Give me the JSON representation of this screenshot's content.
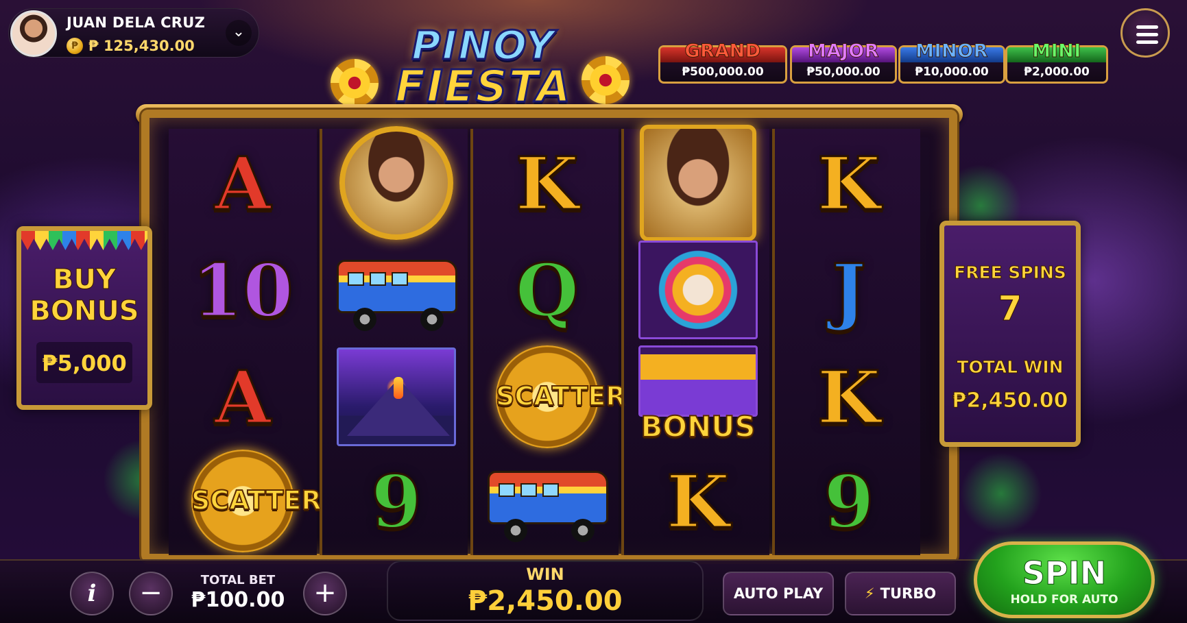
{
  "player": {
    "name": "JUAN DELA CRUZ",
    "currency_symbol": "₱",
    "balance": "125,430.00",
    "expand_icon": "chevron-down-icon"
  },
  "menu": {
    "icon": "hamburger-menu-icon"
  },
  "logo": {
    "line1": "PINOY",
    "line2": "FIESTA"
  },
  "jackpots": [
    {
      "label": "GRAND",
      "value": "₱500,000.00",
      "color": "#e23a2a"
    },
    {
      "label": "MAJOR",
      "value": "₱50,000.00",
      "color": "#c05ae0"
    },
    {
      "label": "MINOR",
      "value": "₱10,000.00",
      "color": "#3a8ae8"
    },
    {
      "label": "MINI",
      "value": "₱2,000.00",
      "color": "#3ec04a"
    }
  ],
  "reels": [
    [
      "A",
      "10",
      "A",
      "SCATTER"
    ],
    [
      "Portrait",
      "Jeepney",
      "Volcano",
      "9"
    ],
    [
      "K",
      "Q",
      "SCATTER",
      "Jeepney"
    ],
    [
      "Portrait",
      "Sun Mask",
      "BONUS",
      "K"
    ],
    [
      "K",
      "J",
      "K",
      "9"
    ]
  ],
  "buy_bonus": {
    "line1": "BUY",
    "line2": "BONUS",
    "price": "₱5,000"
  },
  "free_spins": {
    "label": "FREE SPINS",
    "count": "7",
    "total_win_label": "TOTAL WIN",
    "total_win": "₱2,450.00"
  },
  "controls": {
    "info_label": "i",
    "minus_label": "−",
    "plus_label": "+",
    "total_bet_label": "TOTAL BET",
    "total_bet": "₱100.00",
    "win_label": "WIN",
    "win_value": "₱2,450.00",
    "autoplay_label": "AUTO PLAY",
    "turbo_label": "TURBO",
    "turbo_icon": "lightning-bolt-icon",
    "spin_label": "SPIN",
    "spin_sublabel": "HOLD FOR AUTO"
  },
  "colors": {
    "gold": "#ffd43b",
    "spin_green": "#23a21d",
    "panel_purple": "#4a1d6a"
  }
}
